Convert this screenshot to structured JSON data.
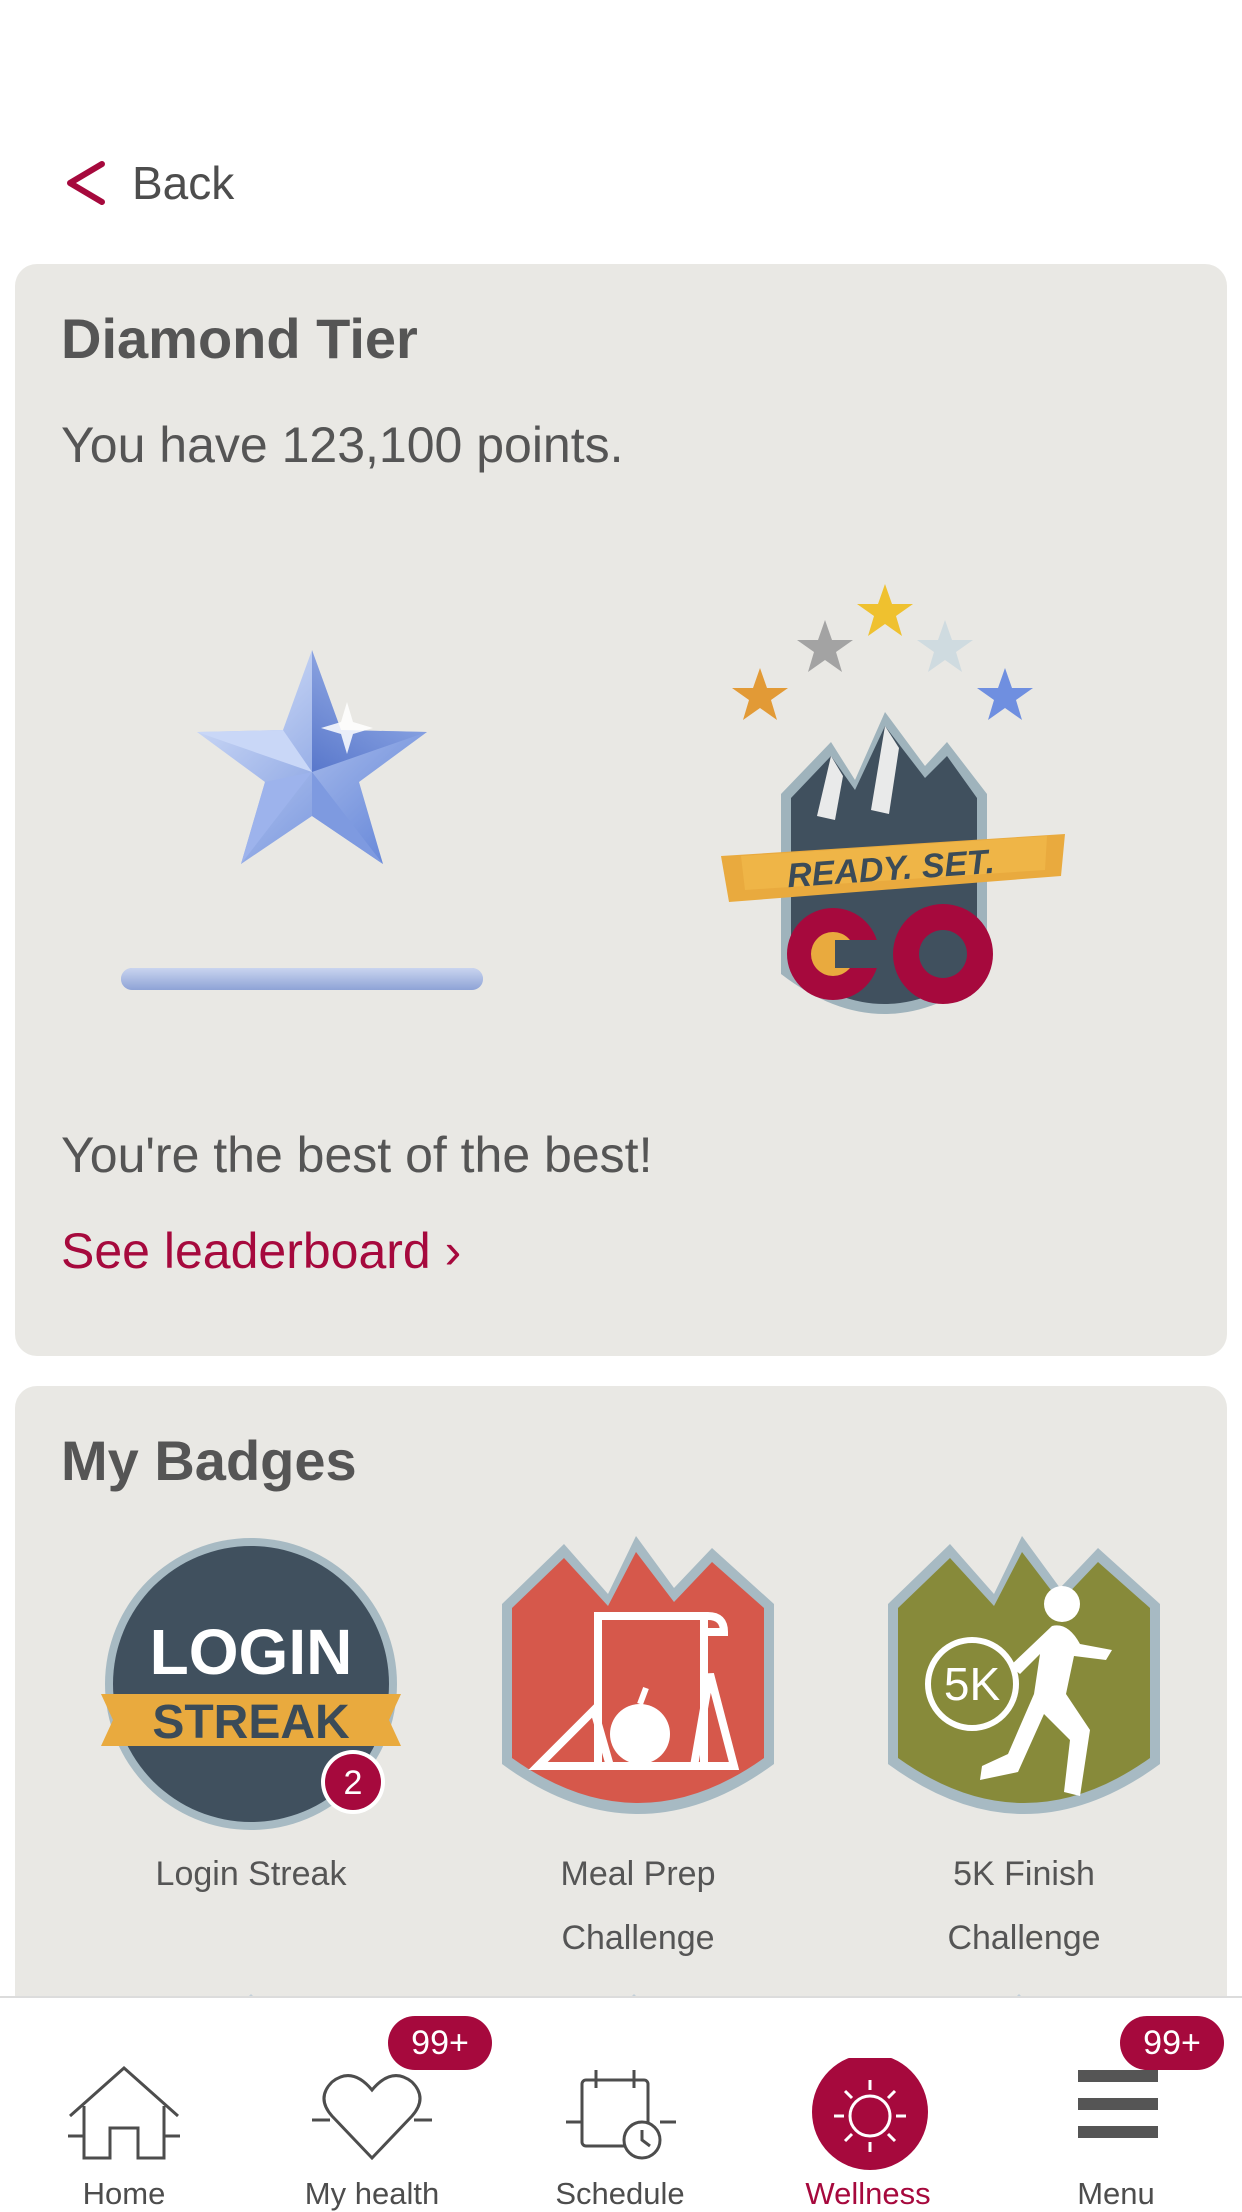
{
  "nav": {
    "back_label": "Back"
  },
  "tier": {
    "title": "Diamond Tier",
    "points_text": "You have 123,100 points.",
    "progress_fraction": 1.0,
    "message": "You're the best of the best!",
    "leaderboard_link": "See leaderboard ›",
    "program_logo": {
      "banner_text": "READY. SET.",
      "letters": "CO"
    }
  },
  "badges": {
    "title": "My Badges",
    "items": [
      {
        "label_lines": [
          "Login Streak"
        ],
        "art_line1": "LOGIN",
        "art_line2": "STREAK",
        "count": "2"
      },
      {
        "label_lines": [
          "Meal Prep",
          "Challenge"
        ]
      },
      {
        "label_lines": [
          "5K Finish",
          "Challenge"
        ],
        "art_text": "5K"
      }
    ]
  },
  "tabbar": {
    "active_color": "#a6093d",
    "items": [
      {
        "label": "Home",
        "icon": "home-icon"
      },
      {
        "label": "My health",
        "icon": "heart-icon",
        "badge": "99+"
      },
      {
        "label": "Schedule",
        "icon": "calendar-clock-icon"
      },
      {
        "label": "Wellness",
        "icon": "sun-icon",
        "active": true
      },
      {
        "label": "Menu",
        "icon": "menu-icon",
        "badge": "99+"
      }
    ]
  }
}
